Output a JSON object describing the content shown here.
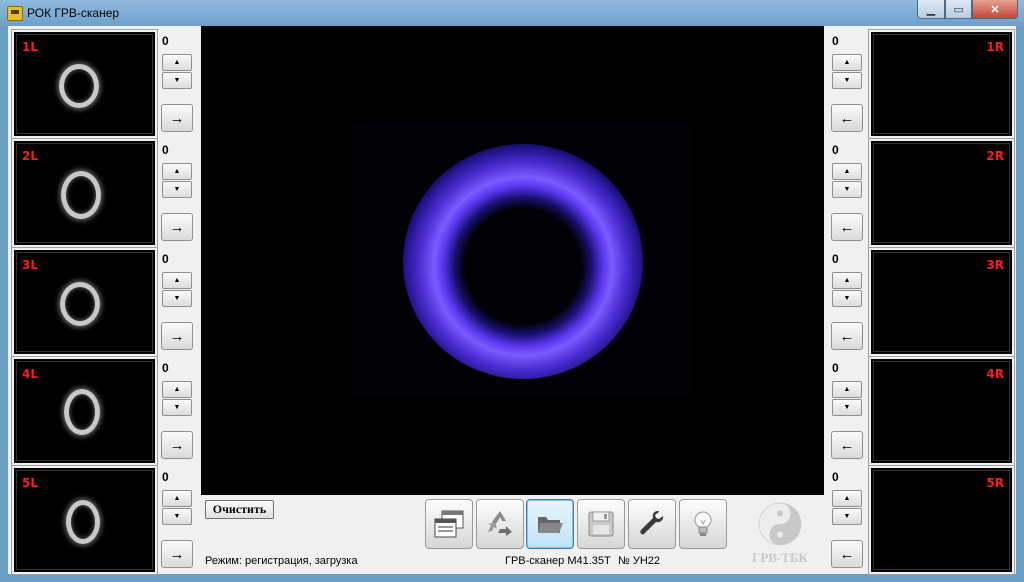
{
  "window": {
    "title": "РОК ГРВ-сканер",
    "min_glyph": "▁",
    "max_glyph": "▭",
    "close_glyph": "✕"
  },
  "left_panels": [
    {
      "label": "1L",
      "count": "0"
    },
    {
      "label": "2L",
      "count": "0"
    },
    {
      "label": "3L",
      "count": "0"
    },
    {
      "label": "4L",
      "count": "0"
    },
    {
      "label": "5L",
      "count": "0"
    }
  ],
  "right_panels": [
    {
      "label": "1R",
      "count": "0"
    },
    {
      "label": "2R",
      "count": "0"
    },
    {
      "label": "3R",
      "count": "0"
    },
    {
      "label": "4R",
      "count": "0"
    },
    {
      "label": "5R",
      "count": "0"
    }
  ],
  "controls": {
    "up_glyph": "▲",
    "down_glyph": "▼",
    "arrow_right": "→",
    "arrow_left": "←"
  },
  "toolbar": {
    "clear_label": "Очистить",
    "icons": [
      "windows-icon",
      "recycle-icon",
      "folder-icon",
      "save-icon",
      "wrench-icon",
      "lightbulb-icon"
    ]
  },
  "logo": {
    "text": "ГРВ-ТБК"
  },
  "status": {
    "mode": "Режим: регистрация, загрузка",
    "device": "ГРВ-сканер М41.35Т",
    "number": "№ УН22"
  },
  "colors": {
    "label_red": "#ff1a1a",
    "glow_violet": "#7a5cff"
  }
}
